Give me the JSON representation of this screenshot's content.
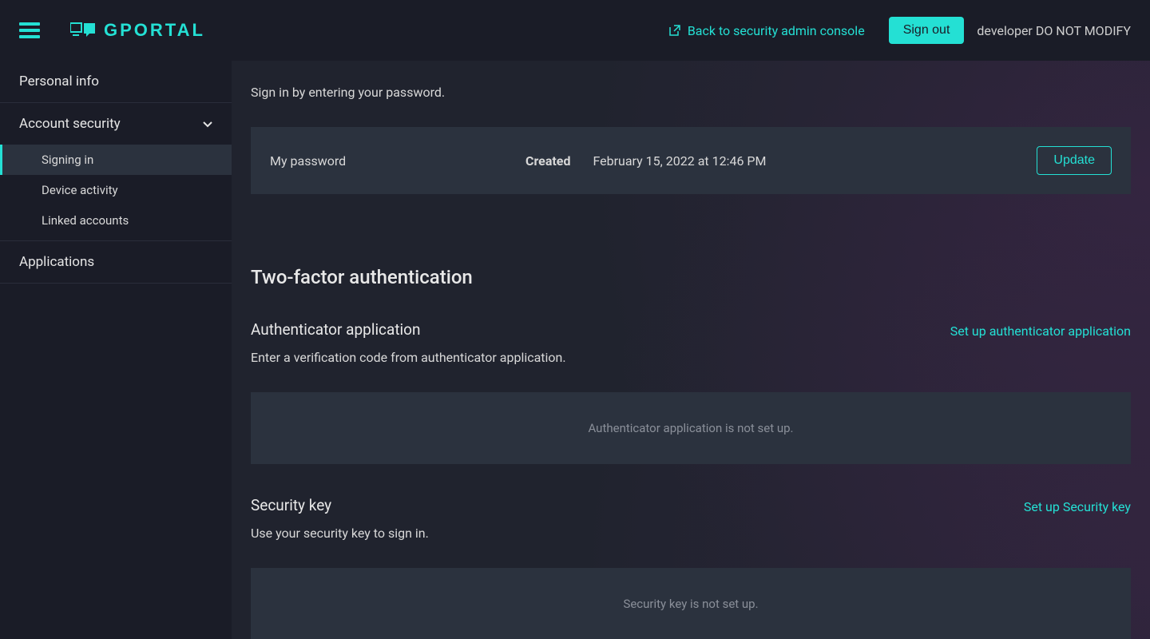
{
  "header": {
    "logo_text": "GPORTAL",
    "back_link": "Back to security admin console",
    "sign_out": "Sign out",
    "user": "developer DO NOT MODIFY"
  },
  "sidebar": {
    "personal_info": "Personal info",
    "account_security": "Account security",
    "signing_in": "Signing in",
    "device_activity": "Device activity",
    "linked_accounts": "Linked accounts",
    "applications": "Applications"
  },
  "main": {
    "password_desc": "Sign in by entering your password.",
    "password_card": {
      "label": "My password",
      "created_label": "Created",
      "created_date": "February 15, 2022 at 12:46 PM",
      "update": "Update"
    },
    "tfa_title": "Two-factor authentication",
    "authenticator": {
      "title": "Authenticator application",
      "setup": "Set up authenticator application",
      "desc": "Enter a verification code from authenticator application.",
      "empty": "Authenticator application is not set up."
    },
    "security_key": {
      "title": "Security key",
      "setup": "Set up Security key",
      "desc": "Use your security key to sign in.",
      "empty": "Security key is not set up."
    }
  },
  "colors": {
    "accent": "#24e0d4",
    "bg_dark": "#1a1c27",
    "bg_panel": "#2b323e"
  }
}
